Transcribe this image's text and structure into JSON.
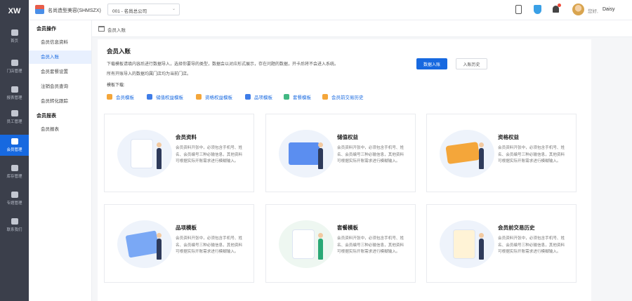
{
  "app": {
    "logo": "XW"
  },
  "rail": [
    {
      "label": "首页",
      "active": false
    },
    {
      "label": "门店管理",
      "active": false
    },
    {
      "label": "报表管理",
      "active": false
    },
    {
      "label": "员工管理",
      "active": false
    },
    {
      "label": "会员管理",
      "active": true
    },
    {
      "label": "库存管理",
      "active": false
    },
    {
      "label": "专题管理",
      "active": false
    },
    {
      "label": "联系我们",
      "active": false
    }
  ],
  "header": {
    "store_name": "名尚造型美容(SHMSZX)",
    "store_select": "001 - 名尚总公司",
    "greeting": "您好,",
    "user_name": "Daisy"
  },
  "submenu": {
    "group1": "会员操作",
    "items1": [
      "会员信息资料",
      "会员入账",
      "会员套餐设置",
      "注销会员查询",
      "会员转化跟踪"
    ],
    "group2": "会员报表",
    "items2": [
      "会员报表"
    ]
  },
  "breadcrumb": "会员入账",
  "main": {
    "title": "会员入账",
    "desc1": "下载模板请填内容后进行数据导入，选择你要导的类型，数据会以对应形式展示，存在问题的数据，开卡后将不会进入系统。",
    "desc2": "所有开账导入的数据均属门店均为当前门店。",
    "download_label": "模板下载:",
    "btn_import": "数据入账",
    "btn_history": "入账历史",
    "templates": [
      {
        "label": "会员模板",
        "color": "#f4a63a"
      },
      {
        "label": "储值权益模板",
        "color": "#3f7de8"
      },
      {
        "label": "资格权益模板",
        "color": "#f4a63a"
      },
      {
        "label": "品项模板",
        "color": "#3f7de8"
      },
      {
        "label": "套餐模板",
        "color": "#42b883"
      },
      {
        "label": "会员前交易历史",
        "color": "#f4a63a"
      }
    ],
    "cards": [
      {
        "title": "会员资料",
        "desc": "会员资料开张中，必须包含手机号、姓名、会员编号三种必输信息，其他资料可根据实际开账需求进行模糊输入。"
      },
      {
        "title": "储值权益",
        "desc": "会员资料开张中，必须包含手机号、姓名、会员编号三种必输信息，其他资料可根据实际开账需求进行模糊输入。"
      },
      {
        "title": "资格权益",
        "desc": "会员资料开张中，必须包含手机号、姓名、会员编号三种必输信息，其他资料可根据实际开账需求进行模糊输入。"
      },
      {
        "title": "品项模板",
        "desc": "会员资料开张中，必须包含手机号、姓名、会员编号三种必输信息，其他资料可根据实际开账需求进行模糊输入。"
      },
      {
        "title": "套餐模板",
        "desc": "会员资料开张中，必须包含手机号、姓名、会员编号三种必输信息，其他资料可根据实际开账需求进行模糊输入。"
      },
      {
        "title": "会员前交易历史",
        "desc": "会员资料开张中，必须包含手机号、姓名、会员编号三种必输信息，其他资料可根据实际开账需求进行模糊输入。"
      }
    ]
  }
}
